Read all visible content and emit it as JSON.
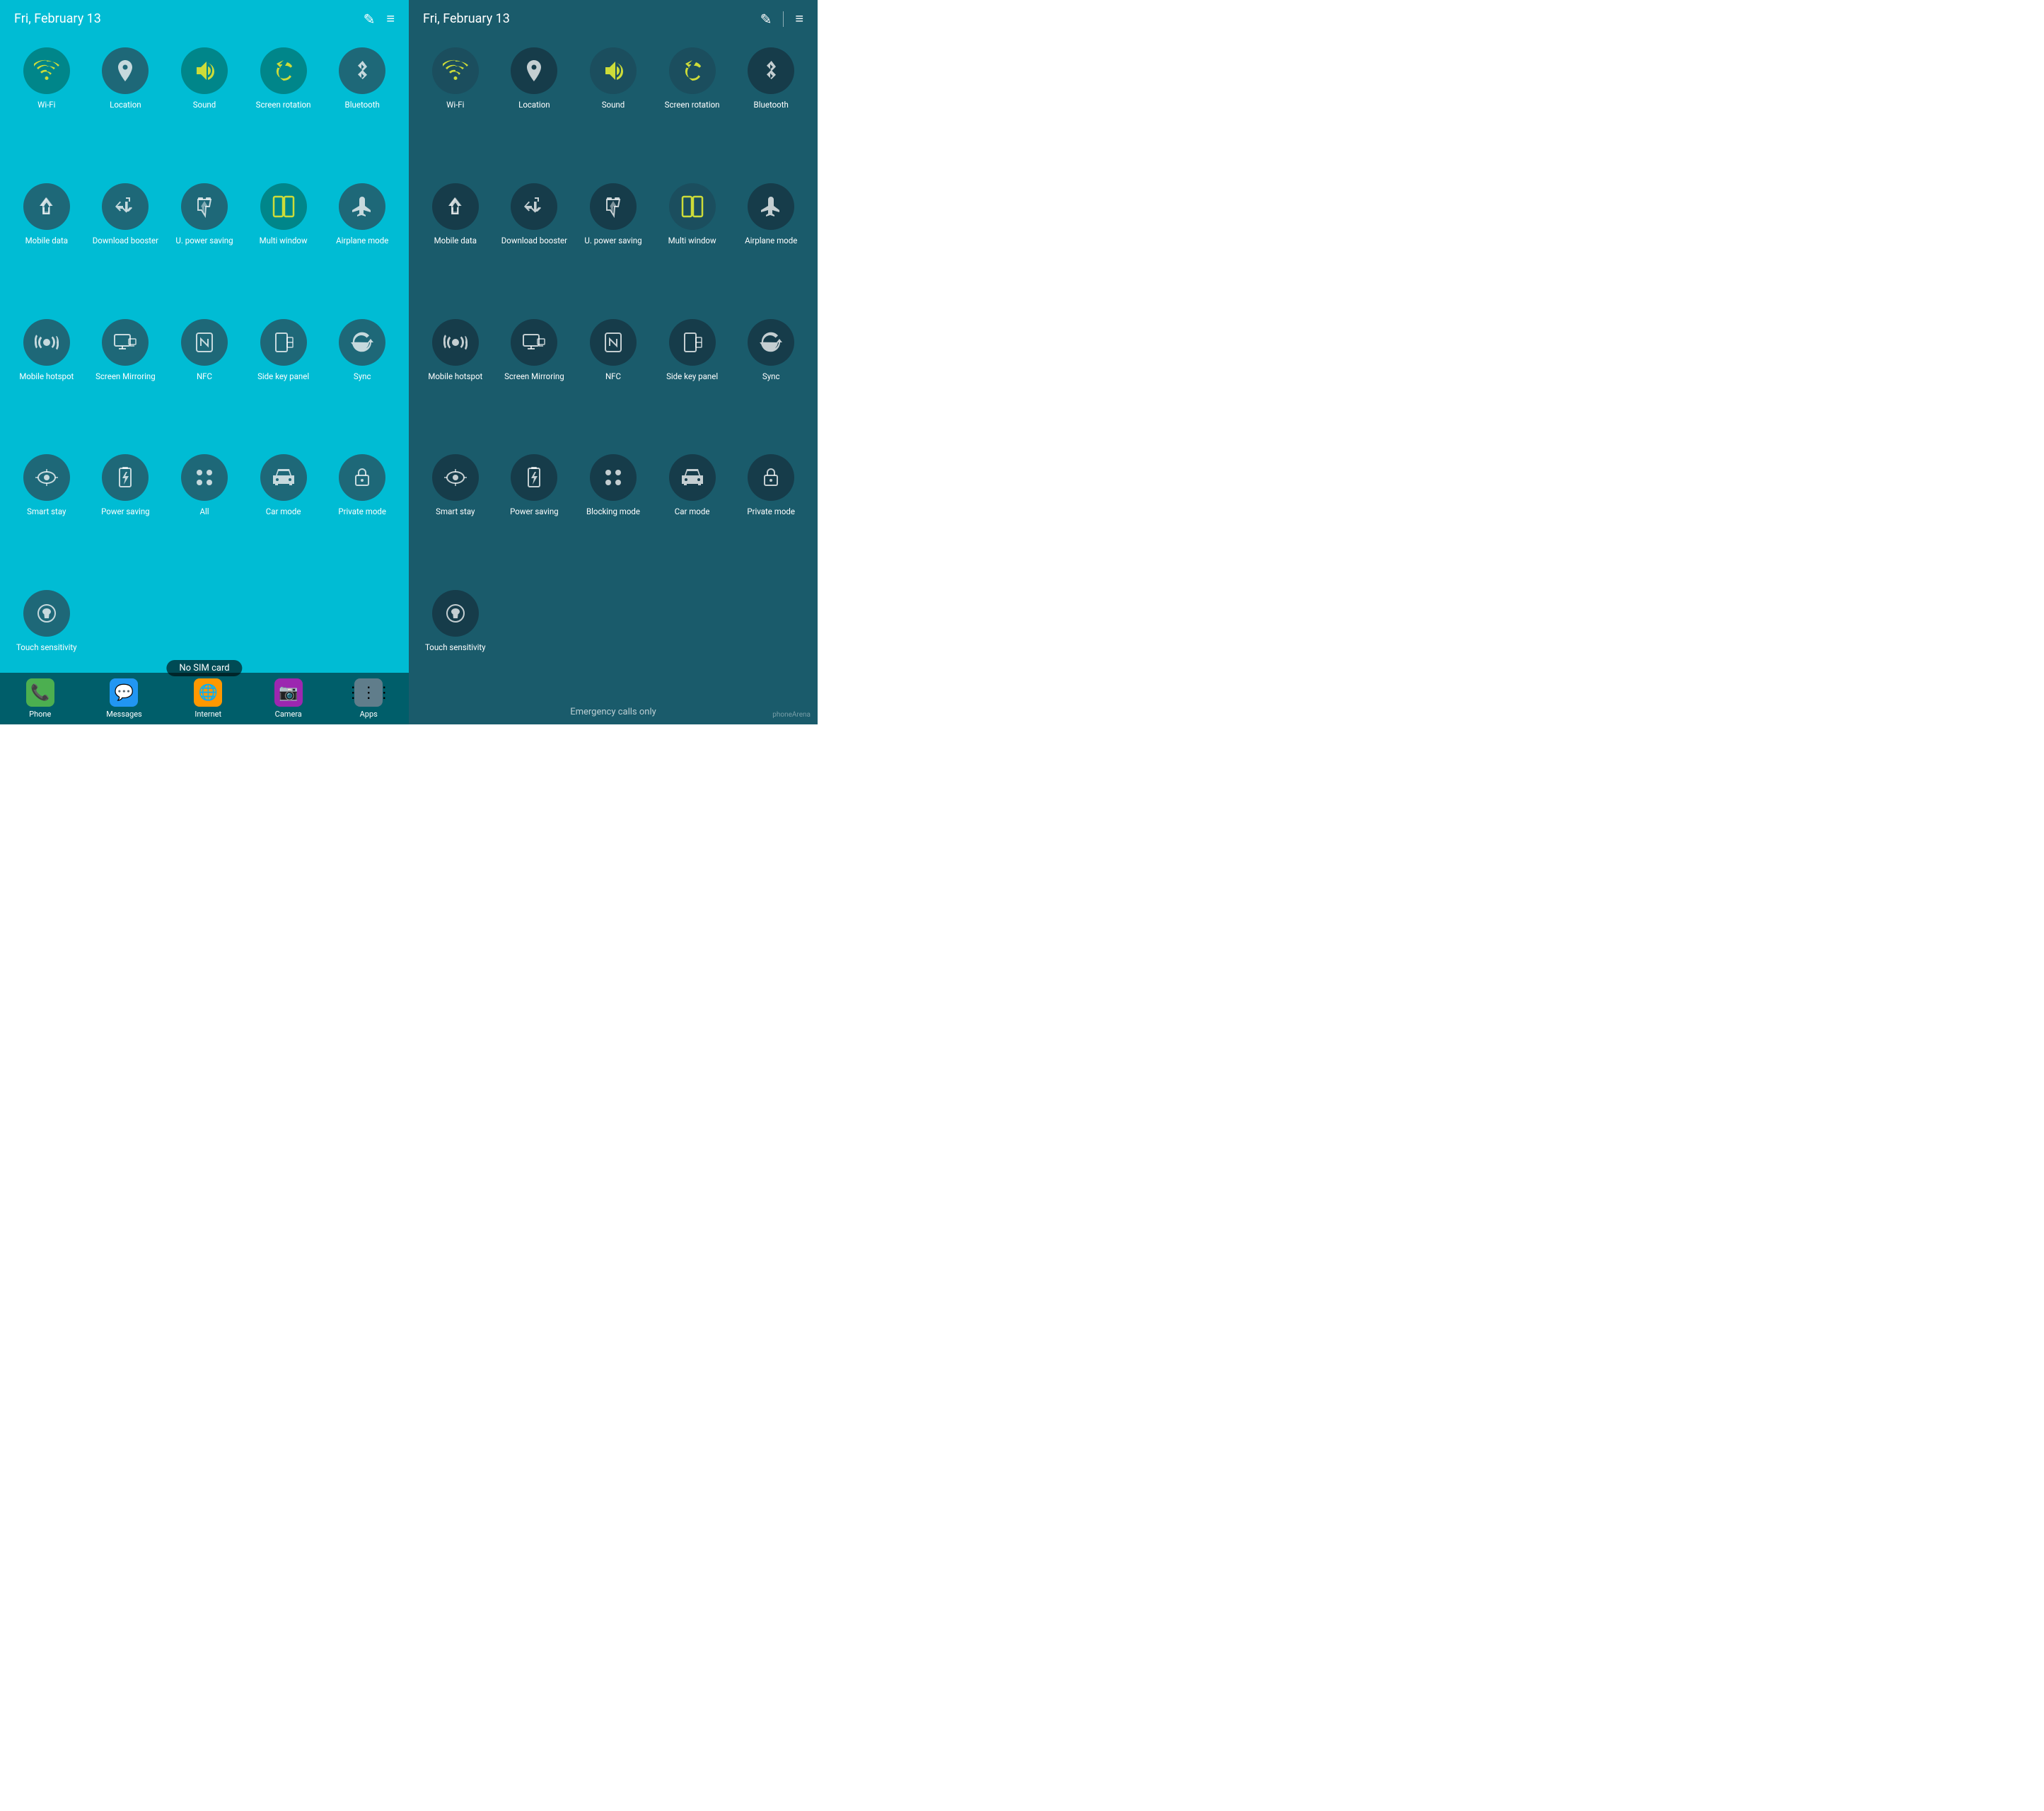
{
  "left": {
    "header": {
      "date": "Fri, February 13",
      "edit_icon": "✎",
      "menu_icon": "≡"
    },
    "items": [
      {
        "id": "wifi",
        "label": "Wi-Fi",
        "active": true,
        "icon_type": "wifi"
      },
      {
        "id": "location",
        "label": "Location",
        "active": false,
        "icon_type": "location"
      },
      {
        "id": "sound",
        "label": "Sound",
        "active": true,
        "icon_type": "sound"
      },
      {
        "id": "screen-rotation",
        "label": "Screen\nrotation",
        "active": true,
        "icon_type": "rotation"
      },
      {
        "id": "bluetooth",
        "label": "Bluetooth",
        "active": false,
        "icon_type": "bluetooth"
      },
      {
        "id": "mobile-data",
        "label": "Mobile\ndata",
        "active": false,
        "icon_type": "mobile-data"
      },
      {
        "id": "download-booster",
        "label": "Download\nbooster",
        "active": false,
        "icon_type": "download-booster"
      },
      {
        "id": "u-power",
        "label": "U. power\nsaving",
        "active": false,
        "icon_type": "u-power"
      },
      {
        "id": "multi-window",
        "label": "Multi\nwindow",
        "active": true,
        "icon_type": "multi-window"
      },
      {
        "id": "airplane",
        "label": "Airplane\nmode",
        "active": false,
        "icon_type": "airplane"
      },
      {
        "id": "mobile-hotspot",
        "label": "Mobile\nhotspot",
        "active": false,
        "icon_type": "hotspot"
      },
      {
        "id": "screen-mirroring",
        "label": "Screen\nMirroring",
        "active": false,
        "icon_type": "screen-mirror"
      },
      {
        "id": "nfc",
        "label": "NFC",
        "active": false,
        "icon_type": "nfc"
      },
      {
        "id": "side-key",
        "label": "Side key\npanel",
        "active": false,
        "icon_type": "side-key"
      },
      {
        "id": "sync",
        "label": "Sync",
        "active": false,
        "icon_type": "sync"
      },
      {
        "id": "smart-stay",
        "label": "Smart\nstay",
        "active": false,
        "icon_type": "smart-stay"
      },
      {
        "id": "power-saving",
        "label": "Power\nsaving",
        "active": false,
        "icon_type": "power-saving"
      },
      {
        "id": "all",
        "label": "All",
        "active": false,
        "icon_type": "all"
      },
      {
        "id": "car-mode",
        "label": "Car\nmode",
        "active": false,
        "icon_type": "car-mode"
      },
      {
        "id": "private-mode",
        "label": "Private\nmode",
        "active": false,
        "icon_type": "private-mode"
      },
      {
        "id": "touch-sensitivity",
        "label": "Touch\nsensitivity",
        "active": false,
        "icon_type": "touch"
      }
    ],
    "bottom": {
      "no_sim": "No SIM card",
      "apps": [
        {
          "label": "Phone",
          "color": "#4CAF50"
        },
        {
          "label": "Messages",
          "color": "#2196F3"
        },
        {
          "label": "Internet",
          "color": "#FF9800"
        },
        {
          "label": "Camera",
          "color": "#9C27B0"
        },
        {
          "label": "Apps",
          "color": "#607D8B"
        }
      ]
    }
  },
  "right": {
    "header": {
      "date": "Fri, February 13",
      "edit_icon": "✎",
      "menu_icon": "≡"
    },
    "items": [
      {
        "id": "wifi",
        "label": "Wi-Fi",
        "active": true,
        "icon_type": "wifi"
      },
      {
        "id": "location",
        "label": "Location",
        "active": false,
        "icon_type": "location"
      },
      {
        "id": "sound",
        "label": "Sound",
        "active": true,
        "icon_type": "sound"
      },
      {
        "id": "screen-rotation",
        "label": "Screen\nrotation",
        "active": true,
        "icon_type": "rotation"
      },
      {
        "id": "bluetooth",
        "label": "Bluetooth",
        "active": false,
        "icon_type": "bluetooth"
      },
      {
        "id": "mobile-data",
        "label": "Mobile\ndata",
        "active": false,
        "icon_type": "mobile-data"
      },
      {
        "id": "download-booster",
        "label": "Download\nbooster",
        "active": false,
        "icon_type": "download-booster"
      },
      {
        "id": "u-power",
        "label": "U. power\nsaving",
        "active": false,
        "icon_type": "u-power"
      },
      {
        "id": "multi-window",
        "label": "Multi\nwindow",
        "active": true,
        "icon_type": "multi-window"
      },
      {
        "id": "airplane",
        "label": "Airplane\nmode",
        "active": false,
        "icon_type": "airplane"
      },
      {
        "id": "mobile-hotspot",
        "label": "Mobile\nhotspot",
        "active": false,
        "icon_type": "hotspot"
      },
      {
        "id": "screen-mirroring",
        "label": "Screen\nMirroring",
        "active": false,
        "icon_type": "screen-mirror"
      },
      {
        "id": "nfc",
        "label": "NFC",
        "active": false,
        "icon_type": "nfc"
      },
      {
        "id": "side-key",
        "label": "Side key\npanel",
        "active": false,
        "icon_type": "side-key"
      },
      {
        "id": "sync",
        "label": "Sync",
        "active": false,
        "icon_type": "sync"
      },
      {
        "id": "smart-stay",
        "label": "Smart\nstay",
        "active": false,
        "icon_type": "smart-stay"
      },
      {
        "id": "power-saving",
        "label": "Power\nsaving",
        "active": false,
        "icon_type": "power-saving"
      },
      {
        "id": "blocking-mode",
        "label": "Blocking\nmode",
        "active": false,
        "icon_type": "all"
      },
      {
        "id": "car-mode",
        "label": "Car\nmode",
        "active": false,
        "icon_type": "car-mode"
      },
      {
        "id": "private-mode",
        "label": "Private\nmode",
        "active": false,
        "icon_type": "private-mode"
      },
      {
        "id": "touch-sensitivity",
        "label": "Touch\nsensitivity",
        "active": false,
        "icon_type": "touch"
      }
    ],
    "emergency": "Emergency calls only",
    "phonearena": "phoneArena"
  }
}
